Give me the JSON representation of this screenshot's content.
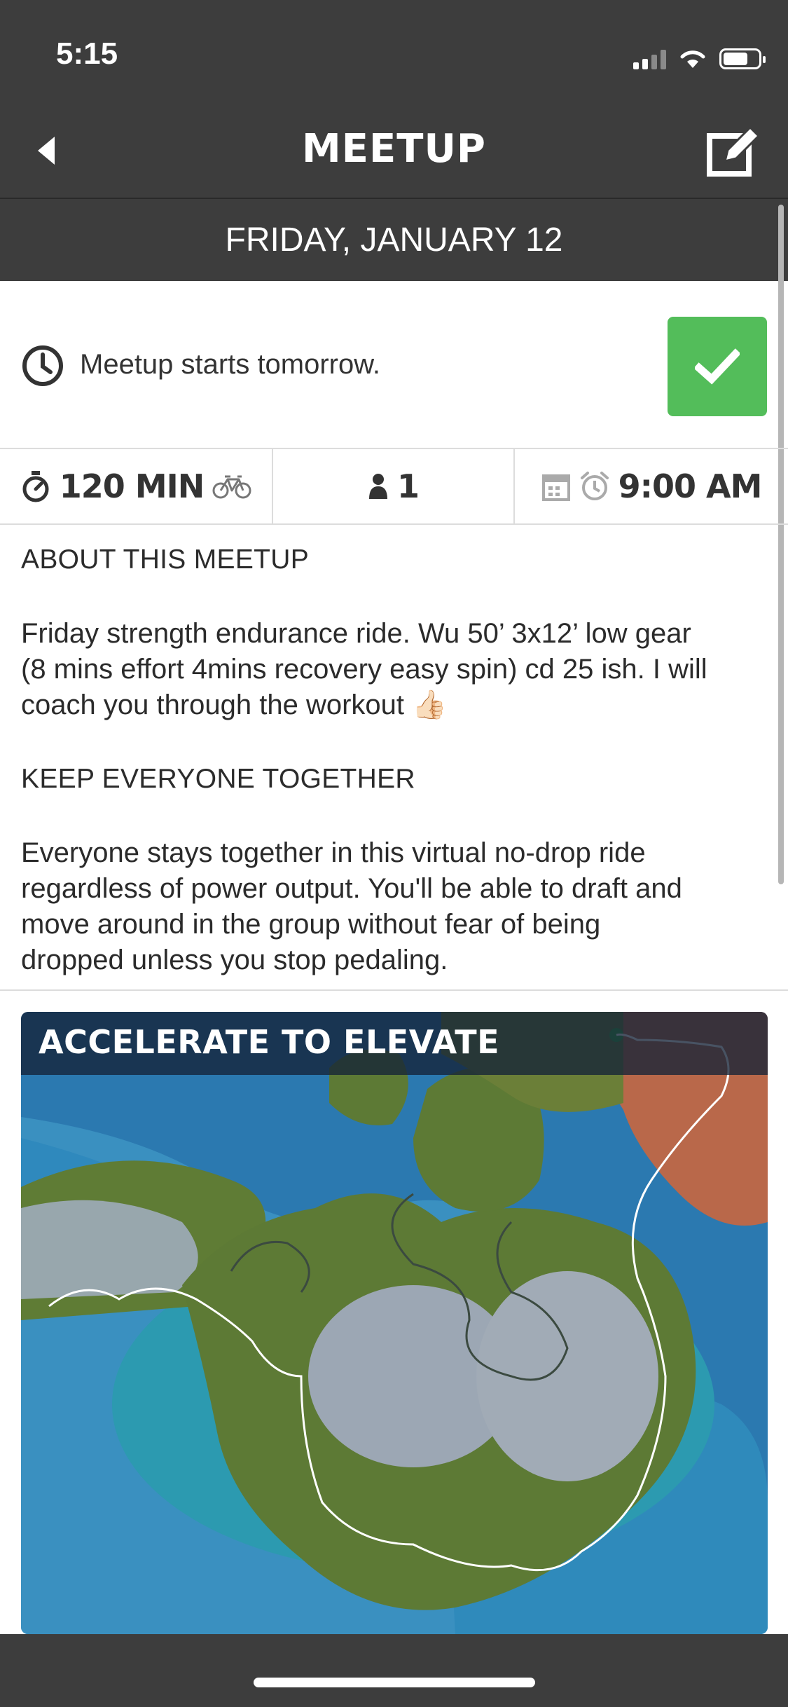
{
  "status_bar": {
    "time": "5:15",
    "icons": [
      "signal-icon",
      "wifi-icon",
      "battery-icon"
    ]
  },
  "nav": {
    "title": "MEETUP",
    "back_icon": "back-arrow-icon",
    "edit_icon": "edit-icon"
  },
  "date_header": "FRIDAY, JANUARY 12",
  "notice": {
    "text": "Meetup starts tomorrow.",
    "icon": "clock-icon",
    "rsvp_icon": "checkmark-icon",
    "rsvp_color": "#53bd5a"
  },
  "stats": {
    "duration": "120 MIN",
    "participants": "1",
    "start_time": "9:00 AM"
  },
  "about": {
    "heading": "ABOUT THIS MEETUP",
    "lines": [
      "Friday strength endurance ride. Wu 50’ 3x12’ low gear",
      "(8 mins effort 4mins recovery easy spin) cd 25 ish. I will",
      "coach you through the workout"
    ],
    "emoji": "👍🏻"
  },
  "together": {
    "heading": "KEEP EVERYONE TOGETHER",
    "lines": [
      "Everyone stays together in this virtual no-drop ride",
      "regardless of power output. You'll be able to draft and",
      "move around in the group without fear of being",
      "dropped unless you stop pedaling."
    ]
  },
  "route_map": {
    "title": "ACCELERATE TO ELEVATE"
  },
  "colors": {
    "bar": "#3d3d3d",
    "accent_green": "#53bd5a",
    "ocean": "#2f7fb3",
    "land": "#5d7a35"
  }
}
